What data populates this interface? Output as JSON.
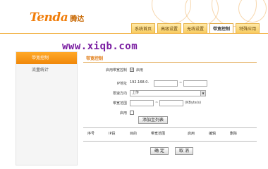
{
  "header": {
    "logo_main": "Tenda",
    "logo_cn": "腾达",
    "tabs": [
      {
        "label": "系统首页"
      },
      {
        "label": "高级设置"
      },
      {
        "label": "无线设置"
      },
      {
        "label": "带宽控制"
      },
      {
        "label": "特殊应用"
      }
    ],
    "active_tab": "带宽控制"
  },
  "sidebar": {
    "items": [
      {
        "label": "带宽控制"
      },
      {
        "label": "流量统计"
      }
    ]
  },
  "watermark": "www.xiqb.com",
  "main": {
    "title": "带宽控制",
    "enable_label": "启用带宽控制",
    "enable_check": "☑",
    "enable_text": "启用",
    "ip_label": "IP地址",
    "ip_start": "192.168.0.",
    "ip_sep": "~",
    "direction_label": "限速方向",
    "direction_value": "上传",
    "bandwidth_label": "带宽范围",
    "bandwidth_sep": "~",
    "bandwidth_unit": "(KByte/s)",
    "enable_row_label": "启用",
    "add_button": "添加至列表",
    "table_headers": [
      "序号",
      "IP段",
      "目的",
      "带宽范围",
      "启用",
      "编辑",
      "删除"
    ],
    "ok_button": "确 定",
    "cancel_button": "取 消"
  }
}
